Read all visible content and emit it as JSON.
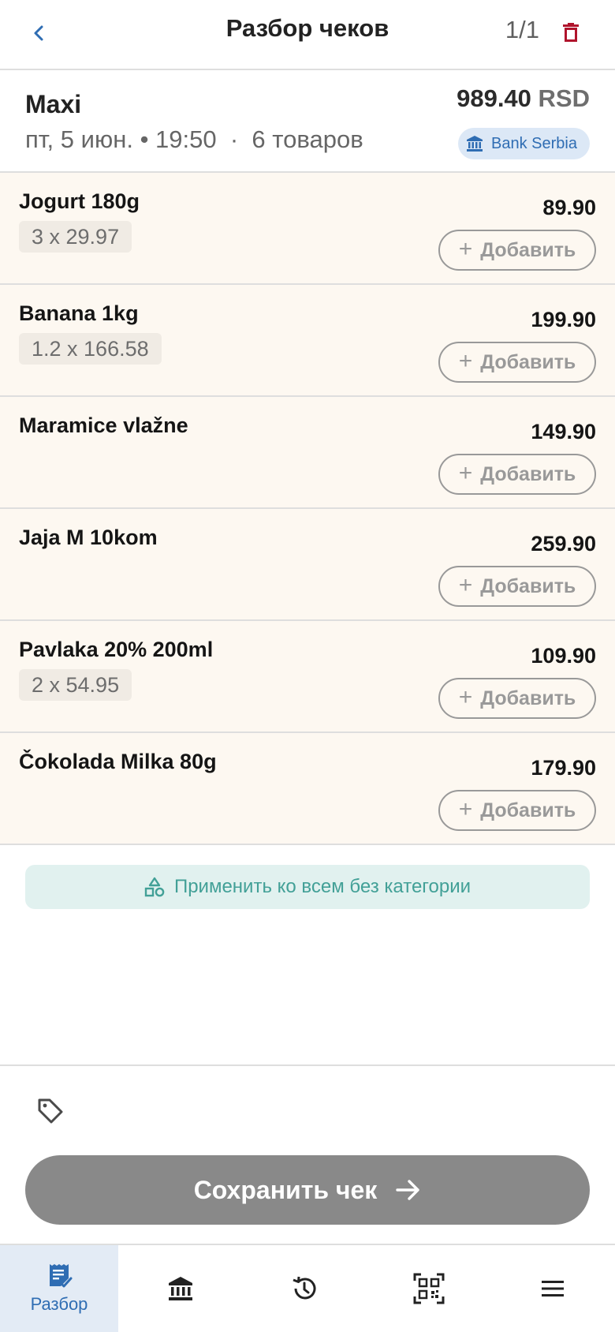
{
  "header": {
    "back_icon": "chevron-left-icon",
    "title": "Разбор чеков",
    "page_counter": "1/1",
    "delete_icon": "trash-icon"
  },
  "receipt": {
    "store": "Maxi",
    "date": "пт, 5 июн.",
    "bullet": "•",
    "time": "19:50",
    "separator": "·",
    "item_count": "6 товаров",
    "total_amount": "989.40",
    "currency": "RSD",
    "bank_icon": "bank-icon",
    "bank": "Bank Serbia"
  },
  "items": [
    {
      "name": "Jogurt 180g",
      "qty": "3 x 29.97",
      "price": "89.90",
      "add_label": "Добавить"
    },
    {
      "name": "Banana 1kg",
      "qty": "1.2 x 166.58",
      "price": "199.90",
      "add_label": "Добавить"
    },
    {
      "name": "Maramice vlažne",
      "qty": "",
      "price": "149.90",
      "add_label": "Добавить"
    },
    {
      "name": "Jaja M 10kom",
      "qty": "",
      "price": "259.90",
      "add_label": "Добавить"
    },
    {
      "name": "Pavlaka 20% 200ml",
      "qty": "2 x 54.95",
      "price": "109.90",
      "add_label": "Добавить"
    },
    {
      "name": "Čokolada Milka 80g",
      "qty": "",
      "price": "179.90",
      "add_label": "Добавить"
    }
  ],
  "apply_all": {
    "icon": "category-shapes-icon",
    "label": "Применить ко всем без категории"
  },
  "footer": {
    "tag_icon": "tag-icon",
    "save_label": "Сохранить чек",
    "save_icon": "arrow-right-icon"
  },
  "nav": {
    "items": [
      {
        "icon": "receipt-review-icon",
        "label": "Разбор",
        "active": true
      },
      {
        "icon": "bank-icon",
        "label": "",
        "active": false
      },
      {
        "icon": "history-icon",
        "label": "",
        "active": false
      },
      {
        "icon": "qr-code-icon",
        "label": "",
        "active": false
      },
      {
        "icon": "menu-icon",
        "label": "",
        "active": false
      }
    ]
  },
  "colors": {
    "accent_blue": "#2f6db3",
    "delete_red": "#b0142c",
    "item_bg": "#fdf8f1",
    "teal": "#42a097",
    "save_bg": "#898989"
  }
}
